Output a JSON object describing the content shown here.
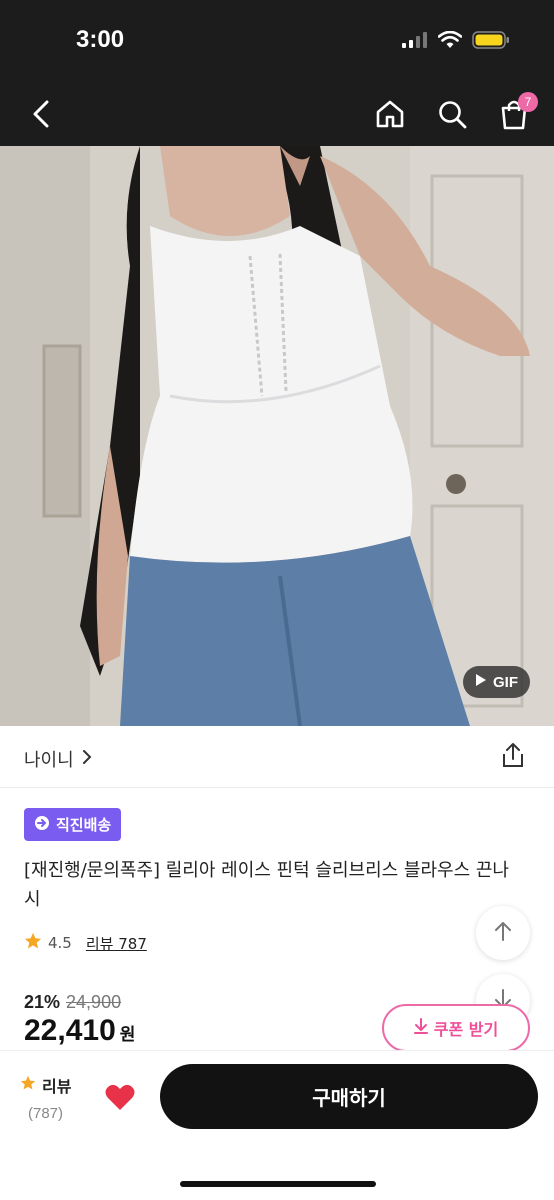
{
  "status": {
    "time": "3:00"
  },
  "nav": {
    "cart_count": "7"
  },
  "hero": {
    "gif_label": "GIF"
  },
  "brand": {
    "name": "나이니"
  },
  "tag": {
    "label": "직진배송"
  },
  "product": {
    "title": "[재진행/문의폭주] 릴리아 레이스 핀턱 슬리브리스 블라우스 끈나시",
    "rating": "4.5",
    "review_label": "리뷰 787",
    "discount": "21%",
    "original_price": "24,900",
    "price": "22,410",
    "price_unit": "원"
  },
  "coupon": {
    "label": "쿠폰 받기"
  },
  "bottom": {
    "review_title": "리뷰",
    "review_count": "(787)",
    "buy_label": "구매하기"
  },
  "colors": {
    "accent_pink": "#ee6aa7",
    "tag_purple": "#7a5cf0",
    "heart_red": "#e8324a",
    "star_orange": "#f5a623"
  }
}
